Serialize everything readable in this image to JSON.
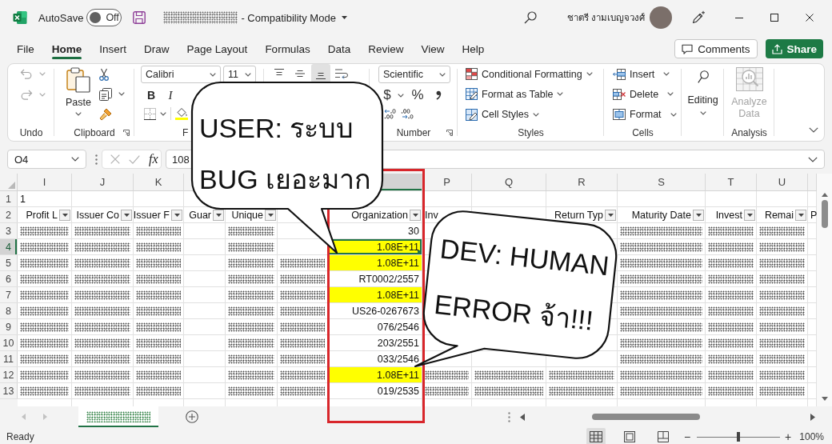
{
  "title_bar": {
    "file_name": {
      "kind": "redacted"
    },
    "autosave": {
      "label": "AutoSave",
      "state": "Off",
      "on": false
    },
    "document_mode": "- Compatibility Mode",
    "user_name": "ชาตรี งามเบญจวงศ์"
  },
  "menu": {
    "tabs": [
      {
        "label": "File",
        "selected": false
      },
      {
        "label": "Home",
        "selected": true
      },
      {
        "label": "Insert",
        "selected": false
      },
      {
        "label": "Draw",
        "selected": false
      },
      {
        "label": "Page Layout",
        "selected": false
      },
      {
        "label": "Formulas",
        "selected": false
      },
      {
        "label": "Data",
        "selected": false
      },
      {
        "label": "Review",
        "selected": false
      },
      {
        "label": "View",
        "selected": false
      },
      {
        "label": "Help",
        "selected": false
      }
    ],
    "buttons": [
      {
        "kind": "comments",
        "label": "Comments"
      },
      {
        "kind": "share",
        "label": "Share"
      }
    ]
  },
  "ribbon": {
    "undo": {
      "label": "Undo",
      "items": [
        {
          "kind": "undo",
          "disabled": true
        },
        {
          "kind": "redo",
          "disabled": true
        }
      ]
    },
    "clipboard": {
      "label": "Clipboard",
      "paste": "Paste"
    },
    "font": {
      "label": "F",
      "font_name": "Calibri",
      "font_size": "11",
      "styles": [
        "B",
        "I"
      ]
    },
    "alignment": {
      "vertical_align": [
        {
          "kind": "top",
          "selected": false
        },
        {
          "kind": "middle",
          "selected": false
        },
        {
          "kind": "bottom",
          "selected": true
        }
      ]
    },
    "number": {
      "label": "Number",
      "format": "Scientific",
      "currency": "$",
      "percent": "%"
    },
    "styles": {
      "label": "Styles",
      "items": [
        {
          "kind": "conditional",
          "label": "Conditional Formatting"
        },
        {
          "kind": "table",
          "label": "Format as Table"
        },
        {
          "kind": "cell_styles",
          "label": "Cell Styles"
        }
      ]
    },
    "cells": {
      "label": "Cells",
      "items": [
        {
          "kind": "insert",
          "label": "Insert"
        },
        {
          "kind": "delete",
          "label": "Delete"
        },
        {
          "kind": "format",
          "label": "Format"
        }
      ]
    },
    "editing": {
      "label": "Editing"
    },
    "analysis": {
      "label": "Analysis",
      "button": {
        "label": "Analyze Data",
        "disabled": true
      }
    }
  },
  "formula_bar": {
    "name_box": "O4",
    "actions": [
      {
        "kind": "cancel",
        "disabled": true
      },
      {
        "kind": "enter",
        "disabled": true
      }
    ],
    "insert_function": "fx",
    "value": "108"
  },
  "grid": {
    "columns": [
      {
        "letter": "I",
        "selected": false
      },
      {
        "letter": "J",
        "selected": false
      },
      {
        "letter": "K",
        "selected": false
      },
      {},
      {},
      {},
      {
        "selected": true
      },
      {
        "letter": "P",
        "selected": false
      },
      {
        "letter": "Q",
        "selected": false
      },
      {
        "letter": "R",
        "selected": false
      },
      {
        "letter": "S",
        "selected": false
      },
      {
        "letter": "T",
        "selected": false
      },
      {
        "letter": "U",
        "selected": false
      },
      {}
    ],
    "rows": [
      {
        "number": "1",
        "selected": false,
        "cells": [
          {
            "kind": "label",
            "text": "1"
          }
        ]
      },
      {
        "number": "2",
        "selected": false,
        "cells": [
          {
            "kind": "header",
            "text": "Profit L",
            "filter": true
          },
          {
            "kind": "header",
            "text": "Issuer Co",
            "filter": true
          },
          {
            "kind": "header",
            "text": "Issuer F",
            "filter": true
          },
          {
            "kind": "header",
            "text": "Guar",
            "filter": true
          },
          {
            "kind": "header",
            "text": "Unique",
            "filter": true
          },
          {
            "kind": "blank"
          },
          {
            "kind": "header",
            "text": "Organization",
            "filter": true
          },
          {
            "kind": "header",
            "text": "Inv",
            "filter": false
          },
          {
            "kind": "blank"
          },
          {
            "kind": "header",
            "text": "Return Typ",
            "filter": true
          },
          {
            "kind": "header",
            "text": "Maturity Date",
            "filter": true
          },
          {
            "kind": "header",
            "text": "Invest",
            "filter": true
          },
          {
            "kind": "header",
            "text": "Remai",
            "filter": true
          },
          {
            "kind": "header",
            "text": "P",
            "filter": false
          }
        ]
      },
      {
        "number": "3",
        "selected": false,
        "cells": [
          {
            "kind": "redacted"
          },
          {
            "kind": "redacted"
          },
          {
            "kind": "redacted"
          },
          {
            "kind": "blank"
          },
          {
            "kind": "redacted"
          },
          {
            "kind": "blank"
          },
          {
            "kind": "value",
            "text": "30",
            "highlight": false
          },
          {
            "kind": "blank"
          },
          {
            "kind": "blank"
          },
          {
            "kind": "blank"
          },
          {
            "kind": "redacted"
          },
          {
            "kind": "redacted"
          },
          {
            "kind": "redacted"
          }
        ]
      },
      {
        "number": "4",
        "selected": true,
        "cells": [
          {
            "kind": "redacted"
          },
          {
            "kind": "redacted"
          },
          {
            "kind": "redacted"
          },
          {
            "kind": "blank"
          },
          {
            "kind": "redacted"
          },
          {
            "kind": "blank"
          },
          {
            "kind": "value",
            "text": "1.08E+11",
            "highlight": true
          },
          {
            "kind": "blank"
          },
          {
            "kind": "blank"
          },
          {
            "kind": "blank"
          },
          {
            "kind": "redacted"
          },
          {
            "kind": "redacted"
          },
          {
            "kind": "redacted"
          }
        ]
      },
      {
        "number": "5",
        "selected": false,
        "cells": [
          {
            "kind": "redacted"
          },
          {
            "kind": "redacted"
          },
          {
            "kind": "redacted"
          },
          {
            "kind": "blank"
          },
          {
            "kind": "redacted"
          },
          {
            "kind": "redacted"
          },
          {
            "kind": "value",
            "text": "1.08E+11",
            "highlight": true
          },
          {
            "kind": "blank"
          },
          {
            "kind": "blank"
          },
          {
            "kind": "blank"
          },
          {
            "kind": "redacted"
          },
          {
            "kind": "redacted"
          },
          {
            "kind": "redacted"
          }
        ]
      },
      {
        "number": "6",
        "selected": false,
        "cells": [
          {
            "kind": "redacted"
          },
          {
            "kind": "redacted"
          },
          {
            "kind": "redacted"
          },
          {
            "kind": "blank"
          },
          {
            "kind": "redacted"
          },
          {
            "kind": "redacted"
          },
          {
            "kind": "value",
            "text": "RT0002/2557",
            "highlight": false
          },
          {
            "kind": "blank"
          },
          {
            "kind": "blank"
          },
          {
            "kind": "blank"
          },
          {
            "kind": "redacted"
          },
          {
            "kind": "redacted"
          },
          {
            "kind": "redacted"
          }
        ]
      },
      {
        "number": "7",
        "selected": false,
        "cells": [
          {
            "kind": "redacted"
          },
          {
            "kind": "redacted"
          },
          {
            "kind": "redacted"
          },
          {
            "kind": "blank"
          },
          {
            "kind": "redacted"
          },
          {
            "kind": "redacted"
          },
          {
            "kind": "value",
            "text": "1.08E+11",
            "highlight": true
          },
          {
            "kind": "blank"
          },
          {
            "kind": "blank"
          },
          {
            "kind": "blank"
          },
          {
            "kind": "redacted"
          },
          {
            "kind": "redacted"
          },
          {
            "kind": "redacted"
          }
        ]
      },
      {
        "number": "8",
        "selected": false,
        "cells": [
          {
            "kind": "redacted"
          },
          {
            "kind": "redacted"
          },
          {
            "kind": "redacted"
          },
          {
            "kind": "blank"
          },
          {
            "kind": "redacted"
          },
          {
            "kind": "redacted"
          },
          {
            "kind": "value",
            "text": "US26-0267673",
            "highlight": false
          },
          {
            "kind": "blank"
          },
          {
            "kind": "blank"
          },
          {
            "kind": "blank"
          },
          {
            "kind": "redacted"
          },
          {
            "kind": "redacted"
          },
          {
            "kind": "redacted"
          }
        ]
      },
      {
        "number": "9",
        "selected": false,
        "cells": [
          {
            "kind": "redacted"
          },
          {
            "kind": "redacted"
          },
          {
            "kind": "redacted"
          },
          {
            "kind": "blank"
          },
          {
            "kind": "redacted"
          },
          {
            "kind": "redacted"
          },
          {
            "kind": "value",
            "text": "076/2546",
            "highlight": false
          },
          {
            "kind": "blank"
          },
          {
            "kind": "blank"
          },
          {
            "kind": "blank"
          },
          {
            "kind": "redacted"
          },
          {
            "kind": "redacted"
          },
          {
            "kind": "redacted"
          }
        ]
      },
      {
        "number": "10",
        "selected": false,
        "cells": [
          {
            "kind": "redacted"
          },
          {
            "kind": "redacted"
          },
          {
            "kind": "redacted"
          },
          {
            "kind": "blank"
          },
          {
            "kind": "redacted"
          },
          {
            "kind": "redacted"
          },
          {
            "kind": "value",
            "text": "203/2551",
            "highlight": false
          },
          {
            "kind": "blank"
          },
          {
            "kind": "blank"
          },
          {
            "kind": "blank"
          },
          {
            "kind": "redacted"
          },
          {
            "kind": "redacted"
          },
          {
            "kind": "redacted"
          }
        ]
      },
      {
        "number": "11",
        "selected": false,
        "cells": [
          {
            "kind": "redacted"
          },
          {
            "kind": "redacted"
          },
          {
            "kind": "redacted"
          },
          {
            "kind": "blank"
          },
          {
            "kind": "redacted"
          },
          {
            "kind": "redacted"
          },
          {
            "kind": "value",
            "text": "033/2546",
            "highlight": false
          },
          {
            "kind": "blank"
          },
          {
            "kind": "blank"
          },
          {
            "kind": "blank"
          },
          {
            "kind": "redacted"
          },
          {
            "kind": "redacted"
          },
          {
            "kind": "redacted"
          }
        ]
      },
      {
        "number": "12",
        "selected": false,
        "cells": [
          {
            "kind": "redacted"
          },
          {
            "kind": "redacted"
          },
          {
            "kind": "redacted"
          },
          {
            "kind": "blank"
          },
          {
            "kind": "redacted"
          },
          {
            "kind": "redacted"
          },
          {
            "kind": "value",
            "text": "1.08E+11",
            "highlight": true
          },
          {
            "kind": "redacted"
          },
          {
            "kind": "redacted"
          },
          {
            "kind": "redacted"
          },
          {
            "kind": "redacted"
          },
          {
            "kind": "redacted"
          },
          {
            "kind": "redacted"
          }
        ]
      },
      {
        "number": "13",
        "selected": false,
        "cells": [
          {
            "kind": "redacted"
          },
          {
            "kind": "redacted"
          },
          {
            "kind": "redacted"
          },
          {
            "kind": "blank"
          },
          {
            "kind": "redacted"
          },
          {
            "kind": "redacted"
          },
          {
            "kind": "value",
            "text": "019/2535",
            "highlight": false
          },
          {
            "kind": "redacted"
          },
          {
            "kind": "redacted"
          },
          {
            "kind": "redacted"
          },
          {
            "kind": "redacted"
          },
          {
            "kind": "redacted"
          },
          {
            "kind": "redacted"
          }
        ]
      }
    ]
  },
  "sheet_tabs": [
    {
      "kind": "redacted",
      "selected": true
    }
  ],
  "status_bar": {
    "status": "Ready",
    "views": [
      {
        "kind": "normal",
        "selected": true
      },
      {
        "kind": "page_layout",
        "selected": false
      },
      {
        "kind": "page_break",
        "selected": false
      }
    ],
    "zoom": {
      "out": "−",
      "in": "+",
      "level": 0.5,
      "reading": "100%"
    }
  },
  "speech_bubbles": [
    {
      "lines": [
        "USER: ระบบ",
        "BUG เยอะมาก"
      ]
    },
    {
      "lines": [
        "DEV: HUMAN",
        "ERROR จ้า!!!"
      ]
    }
  ],
  "column_outline": true
}
